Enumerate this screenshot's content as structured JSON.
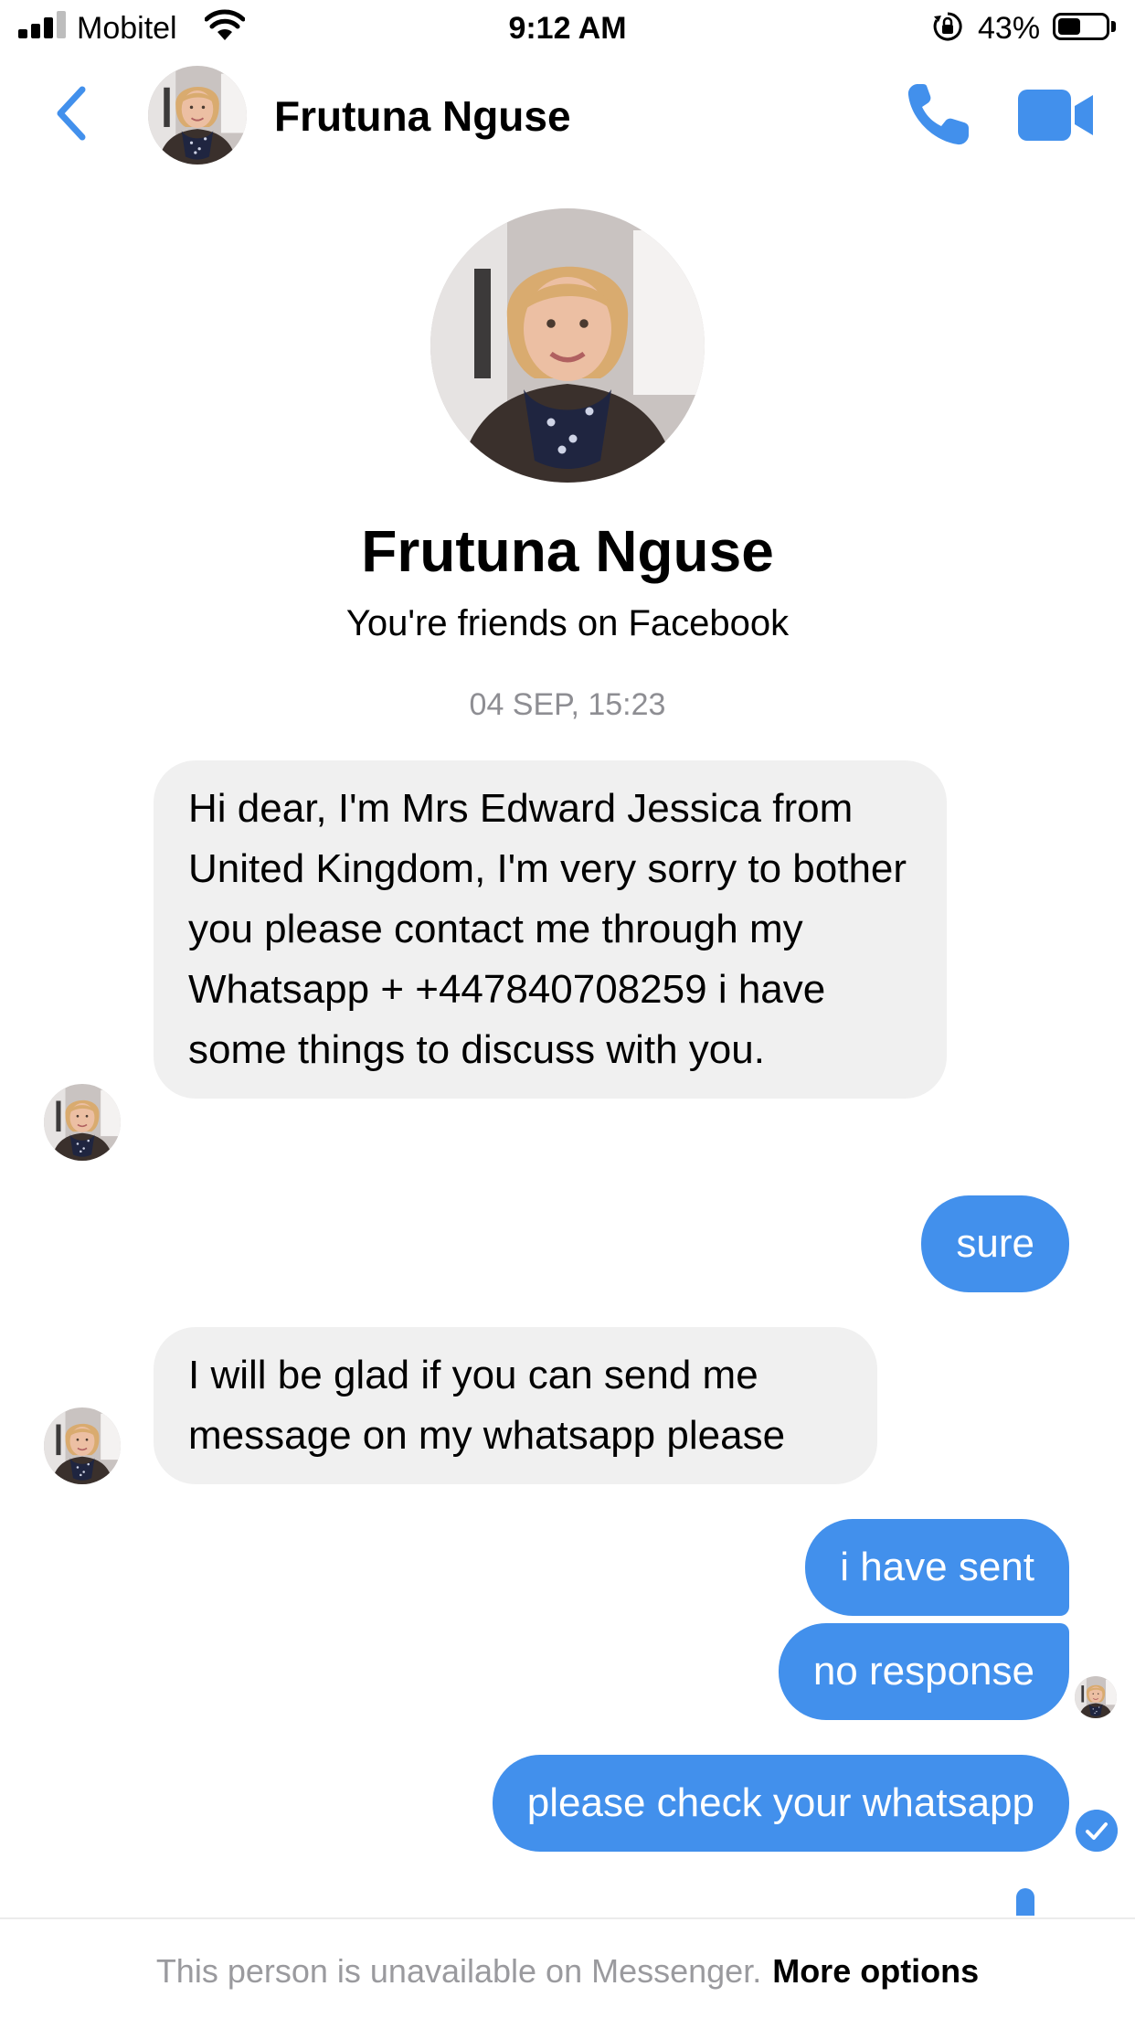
{
  "status_bar": {
    "carrier": "Mobitel",
    "time": "9:12 AM",
    "battery_percent": "43%",
    "battery_level": 0.43,
    "icons": [
      "signal-icon",
      "wifi-icon",
      "rotation-lock-icon",
      "battery-icon"
    ]
  },
  "header": {
    "contact_name": "Frutuna Nguse",
    "icons": [
      "back-chevron-icon",
      "phone-call-icon",
      "video-call-icon"
    ]
  },
  "profile": {
    "name": "Frutuna Nguse",
    "subtitle": "You're friends on Facebook"
  },
  "conversation": {
    "timestamp": "04 SEP, 15:23",
    "messages": [
      {
        "direction": "incoming",
        "text": "Hi dear, I'm Mrs Edward Jessica from United Kingdom, I'm very sorry to bother you please contact me through my  Whatsapp + +447840708259  i have some things to discuss with you."
      },
      {
        "direction": "outgoing",
        "text": "sure"
      },
      {
        "direction": "incoming",
        "text": "I will be glad if you can send me message on my whatsapp please"
      },
      {
        "direction": "outgoing",
        "text": "i have sent"
      },
      {
        "direction": "outgoing",
        "text": "no response"
      },
      {
        "direction": "outgoing",
        "text": "please check your whatsapp"
      }
    ]
  },
  "colors": {
    "accent": "#4290ec",
    "incoming_bubble": "#f0f0f0",
    "muted_text": "#8e8e93"
  },
  "footer": {
    "notice": "This person is unavailable on Messenger.",
    "link": "More options"
  }
}
